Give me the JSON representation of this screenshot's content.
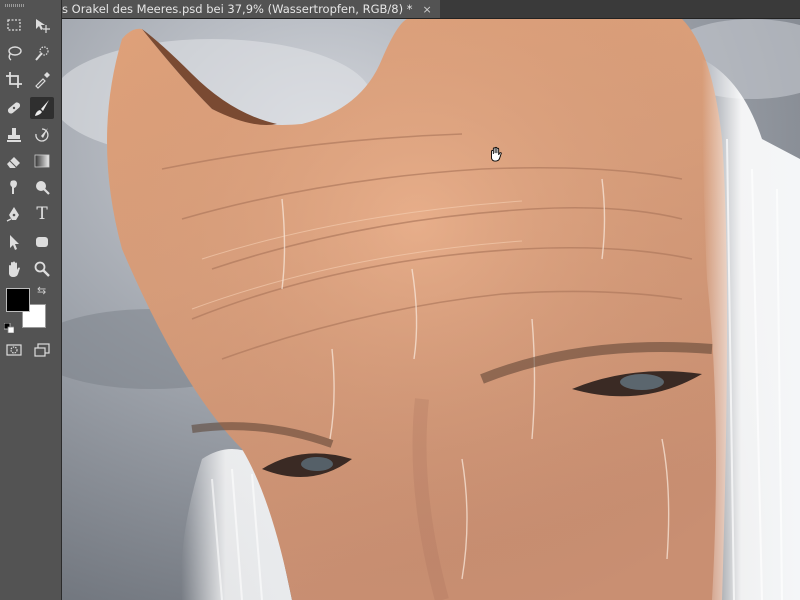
{
  "document_tab": {
    "title": "s Orakel des Meeres.psd bei 37,9% (Wassertropfen, RGB/8) *",
    "close_glyph": "×"
  },
  "tools": [
    {
      "name": "rectangular-marquee-tool",
      "icon": "marquee-icon",
      "active": false
    },
    {
      "name": "move-tool",
      "icon": "move-icon",
      "active": false
    },
    {
      "name": "lasso-tool",
      "icon": "lasso-icon",
      "active": false
    },
    {
      "name": "quick-selection-tool",
      "icon": "quick-selection-icon",
      "active": false
    },
    {
      "name": "crop-tool",
      "icon": "crop-icon",
      "active": false
    },
    {
      "name": "eyedropper-tool",
      "icon": "eyedropper-icon",
      "active": false
    },
    {
      "name": "healing-brush-tool",
      "icon": "bandage-icon",
      "active": false
    },
    {
      "name": "brush-tool",
      "icon": "brush-icon",
      "active": true
    },
    {
      "name": "clone-stamp-tool",
      "icon": "stamp-icon",
      "active": false
    },
    {
      "name": "history-brush-tool",
      "icon": "history-brush-icon",
      "active": false
    },
    {
      "name": "eraser-tool",
      "icon": "eraser-icon",
      "active": false
    },
    {
      "name": "gradient-tool",
      "icon": "gradient-icon",
      "active": false
    },
    {
      "name": "smudge-tool",
      "icon": "smudge-icon",
      "active": false
    },
    {
      "name": "dodge-tool",
      "icon": "dodge-icon",
      "active": false
    },
    {
      "name": "pen-tool",
      "icon": "pen-icon",
      "active": false
    },
    {
      "name": "type-tool",
      "icon": "type-icon",
      "active": false,
      "glyph": "T"
    },
    {
      "name": "path-selection-tool",
      "icon": "arrow-icon",
      "active": false
    },
    {
      "name": "shape-tool",
      "icon": "rounded-rect-icon",
      "active": false
    },
    {
      "name": "hand-tool",
      "icon": "hand-icon",
      "active": false
    },
    {
      "name": "zoom-tool",
      "icon": "magnifier-icon",
      "active": false
    },
    {
      "name": "quick-mask-tool",
      "icon": "quick-mask-icon",
      "active": false
    },
    {
      "name": "screen-mode-tool",
      "icon": "screen-mode-icon",
      "active": false
    }
  ],
  "colors": {
    "foreground": "#000000",
    "background": "#ffffff",
    "panel": "#535353",
    "tabbar": "#3a3a3a"
  },
  "canvas": {
    "cursor": "hand-cursor-icon"
  }
}
